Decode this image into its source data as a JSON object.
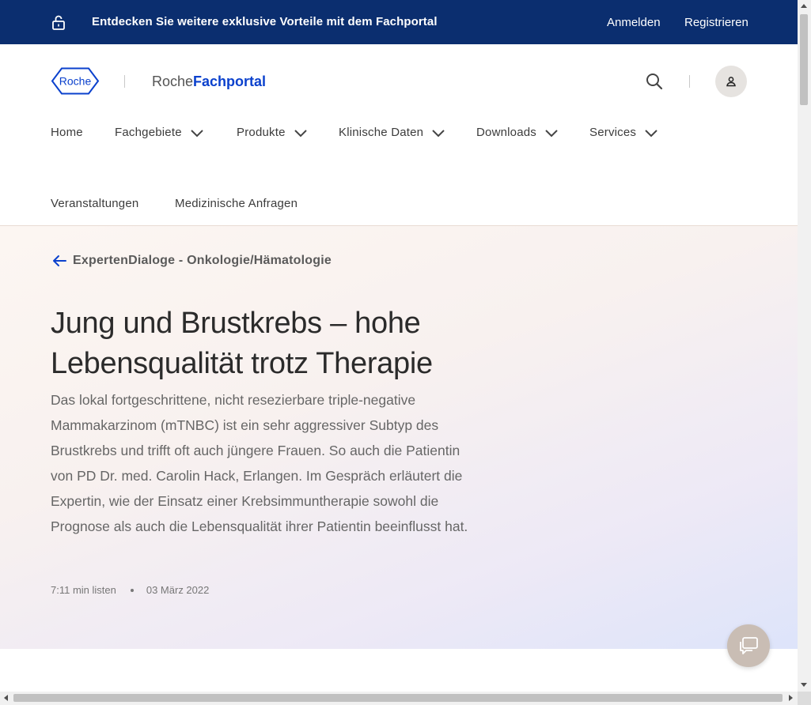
{
  "topbar": {
    "promo": "Entdecken Sie weitere exklusive Vorteile mit dem Fachportal",
    "login": "Anmelden",
    "register": "Registrieren"
  },
  "header": {
    "logo_text": "Roche",
    "portal_prefix": "Roche",
    "portal_name": "Fachportal"
  },
  "nav": {
    "items": [
      {
        "label": "Home"
      },
      {
        "label": "Fachgebiete"
      },
      {
        "label": "Produkte"
      },
      {
        "label": "Klinische Daten"
      },
      {
        "label": "Downloads"
      },
      {
        "label": "Services"
      }
    ],
    "items_row2": [
      {
        "label": "Veranstaltungen"
      },
      {
        "label": "Medizinische Anfragen"
      }
    ]
  },
  "article": {
    "back_label": "ExpertenDialoge - Onkologie/Hämatologie",
    "title_line1": "Jung und Brustkrebs – hohe",
    "title_line2": "Lebensqualität trotz Therapie",
    "lead": "Das lokal fortgeschrittene, nicht resezierbare triple-negative Mammakarzinom (mTNBC) ist ein sehr aggressiver Subtyp des Brustkrebs und trifft oft auch jüngere Frauen. So auch die Patientin von PD Dr. med. Carolin Hack, Erlangen. Im Gespräch erläutert die Expertin, wie der Einsatz einer Krebsimmuntherapie sowohl die Prognose als auch die Lebensqualität ihrer Patientin beeinflusst hat.",
    "read_time": "7:11 min listen",
    "date": "03 März 2022"
  },
  "icons": {
    "lock": "lock-icon",
    "search": "search-icon",
    "user": "user-icon",
    "chevron": "chevron-down-icon",
    "back": "arrow-left-icon",
    "chat": "chat-icon"
  },
  "colors": {
    "topbar_bg": "#0b2e6f",
    "brand_blue": "#0b41cd",
    "chat_bg": "#c9bdb4"
  }
}
